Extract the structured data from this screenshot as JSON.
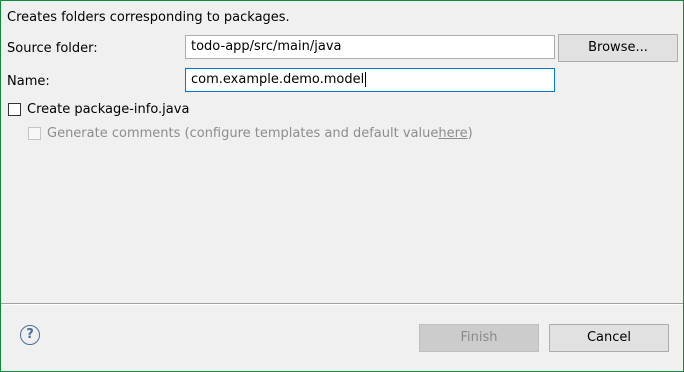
{
  "description": "Creates folders corresponding to packages.",
  "source_folder": {
    "label": "Source folder:",
    "value": "todo-app/src/main/java",
    "browse_label": "Browse..."
  },
  "name": {
    "label": "Name:",
    "value": "com.example.demo.model"
  },
  "package_info": {
    "label": "Create package-info.java",
    "checked": false
  },
  "generate_comments": {
    "text": "Generate comments (configure templates and default value ",
    "link": "here",
    "suffix": ")",
    "checked": false,
    "enabled": false
  },
  "footer": {
    "help_icon": "help-icon",
    "finish_label": "Finish",
    "finish_enabled": false,
    "cancel_label": "Cancel"
  },
  "colors": {
    "focus_border": "#0078d7",
    "window_border": "#0e8a3c",
    "help_icon": "#4a6e9a"
  }
}
